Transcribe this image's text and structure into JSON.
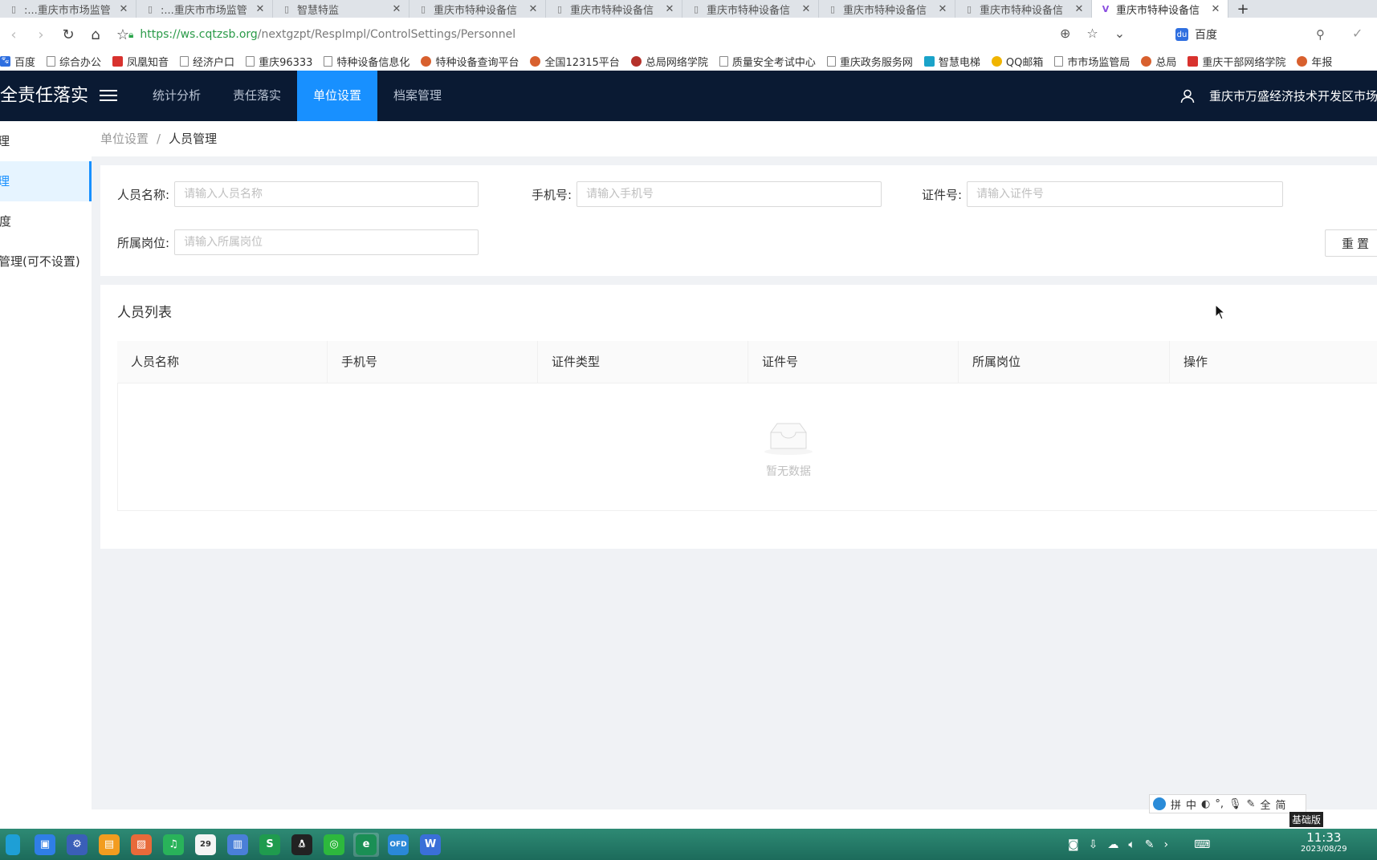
{
  "browser": {
    "tabs": [
      {
        "title": ":...重庆市市场监管",
        "active": false
      },
      {
        "title": ":...重庆市市场监管",
        "active": false
      },
      {
        "title": "智慧特监",
        "active": false
      },
      {
        "title": "重庆市特种设备信",
        "active": false
      },
      {
        "title": "重庆市特种设备信",
        "active": false
      },
      {
        "title": "重庆市特种设备信",
        "active": false
      },
      {
        "title": "重庆市特种设备信",
        "active": false
      },
      {
        "title": "重庆市特种设备信",
        "active": false
      },
      {
        "title": "重庆市特种设备信",
        "active": true
      }
    ],
    "new_tab": "+",
    "url_host": "https://ws.cqtzsb.org",
    "url_path": "/nextgzpt/RespImpl/ControlSettings/Personnel",
    "search_text": "百度",
    "bookmarks": [
      "百度",
      "综合办公",
      "凤凰知音",
      "经济户口",
      "重庆96333",
      "特种设备信息化",
      "特种设备查询平台",
      "全国12315平台",
      "总局网络学院",
      "质量安全考试中心",
      "重庆政务服务网",
      "智慧电梯",
      "QQ邮箱",
      "市市场监管局",
      "总局",
      "重庆干部网络学院",
      "年报"
    ]
  },
  "header": {
    "app_title": "特种设备安全责任落实",
    "nav": [
      "统计分析",
      "责任落实",
      "单位设置",
      "档案管理"
    ],
    "active_nav": "单位设置",
    "user_name": "重庆市万盛经济技术开发区市场监督管理局"
  },
  "sidebar": {
    "items": [
      {
        "label": "单位管理",
        "active": false
      },
      {
        "label": "人员管理",
        "active": true
      },
      {
        "label": "制度",
        "active": false
      },
      {
        "label": "岗位管理(可不设置)",
        "active": false
      }
    ]
  },
  "breadcrumb": {
    "parent": "单位设置",
    "separator": "/",
    "current": "人员管理"
  },
  "search": {
    "name_label": "人员名称:",
    "name_placeholder": "请输入人员名称",
    "phone_label": "手机号:",
    "phone_placeholder": "请输入手机号",
    "cert_label": "证件号:",
    "cert_placeholder": "请输入证件号",
    "post_label": "所属岗位:",
    "post_placeholder": "请输入所属岗位",
    "reset_label": "重置"
  },
  "list": {
    "title": "人员列表",
    "columns": [
      "人员名称",
      "手机号",
      "证件类型",
      "证件号",
      "所属岗位",
      "操作"
    ],
    "empty_text": "暂无数据"
  },
  "ime": {
    "items": [
      "拼",
      "中",
      "全",
      "简"
    ],
    "tag": "基础版"
  },
  "taskbar": {
    "time": "11:33",
    "date": "2023/08/29"
  },
  "colors": {
    "primary": "#1890ff",
    "header_bg": "#0a1a33",
    "page_bg": "#f0f2f5"
  }
}
